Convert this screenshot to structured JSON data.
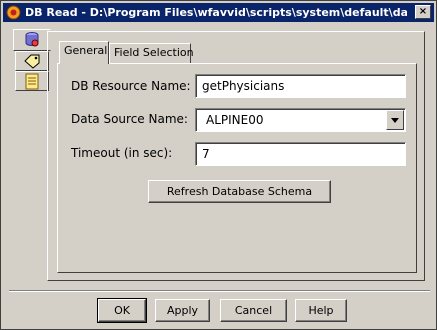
{
  "window": {
    "title": "DB Read - D:\\Program Files\\wfavvid\\scripts\\system\\default\\datab...",
    "close_label": "×"
  },
  "side_tabs": [
    {
      "icon": "database-icon"
    },
    {
      "icon": "tag-icon"
    },
    {
      "icon": "document-icon"
    }
  ],
  "tabs": {
    "general": "General",
    "field_selection": "Field Selection"
  },
  "form": {
    "resource_name_label": "DB Resource Name:",
    "resource_name_value": "getPhysicians",
    "data_source_label": "Data Source Name:",
    "data_source_value": "ALPINE00",
    "timeout_label": "Timeout (in sec):",
    "timeout_value": "7",
    "refresh_label": "Refresh Database Schema"
  },
  "buttons": {
    "ok": "OK",
    "apply": "Apply",
    "cancel": "Cancel",
    "help": "Help"
  }
}
